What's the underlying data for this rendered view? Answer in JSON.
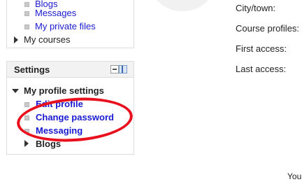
{
  "navigation": {
    "items": [
      {
        "label": "Blogs",
        "type": "link"
      },
      {
        "label": "Messages",
        "type": "link"
      },
      {
        "label": "My private files",
        "type": "link"
      },
      {
        "label": "My courses",
        "type": "expandable"
      }
    ]
  },
  "settings": {
    "title": "Settings",
    "profile_settings_label": "My profile settings",
    "links": {
      "edit_profile": "Edit profile",
      "change_password": "Change password",
      "messaging": "Messaging"
    },
    "blogs_label": "Blogs"
  },
  "profile": {
    "fields": {
      "city_town": "City/town:",
      "course_profiles": "Course profiles:",
      "first_access": "First access:",
      "last_access": "Last access:"
    }
  },
  "footer": {
    "text": "You"
  },
  "colors": {
    "link": "#1a1ad2",
    "annotation": "#e8101c",
    "header_bg": "#f2f2f2",
    "border": "#dddddd"
  }
}
